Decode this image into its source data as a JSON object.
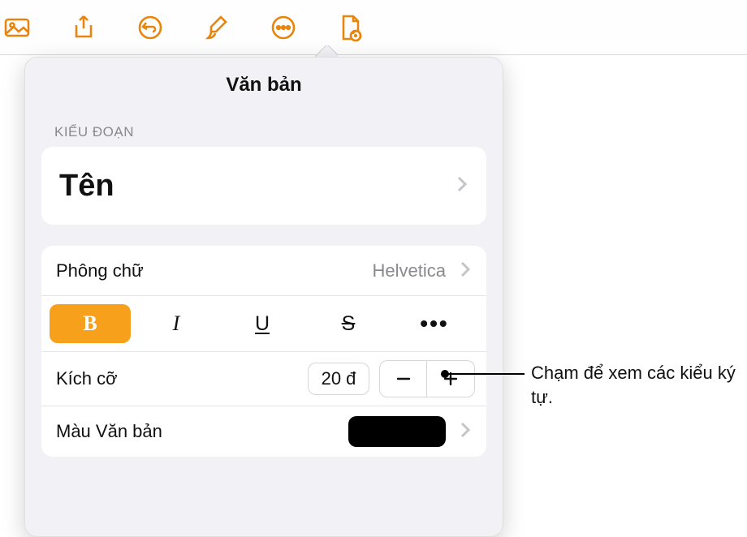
{
  "popoverTitle": "Văn bản",
  "sectionLabel": "KIỂU ĐOẠN",
  "paragraphStyle": "Tên",
  "fontRow": {
    "label": "Phông chữ",
    "value": "Helvetica"
  },
  "styleButtons": {
    "bold": "B",
    "italic": "I",
    "underline": "U",
    "strike": "S"
  },
  "sizeRow": {
    "label": "Kích cỡ",
    "value": "20 đ"
  },
  "colorRow": {
    "label": "Màu Văn bản",
    "colorHex": "#000000"
  },
  "callout": "Chạm để xem các kiểu ký tự."
}
